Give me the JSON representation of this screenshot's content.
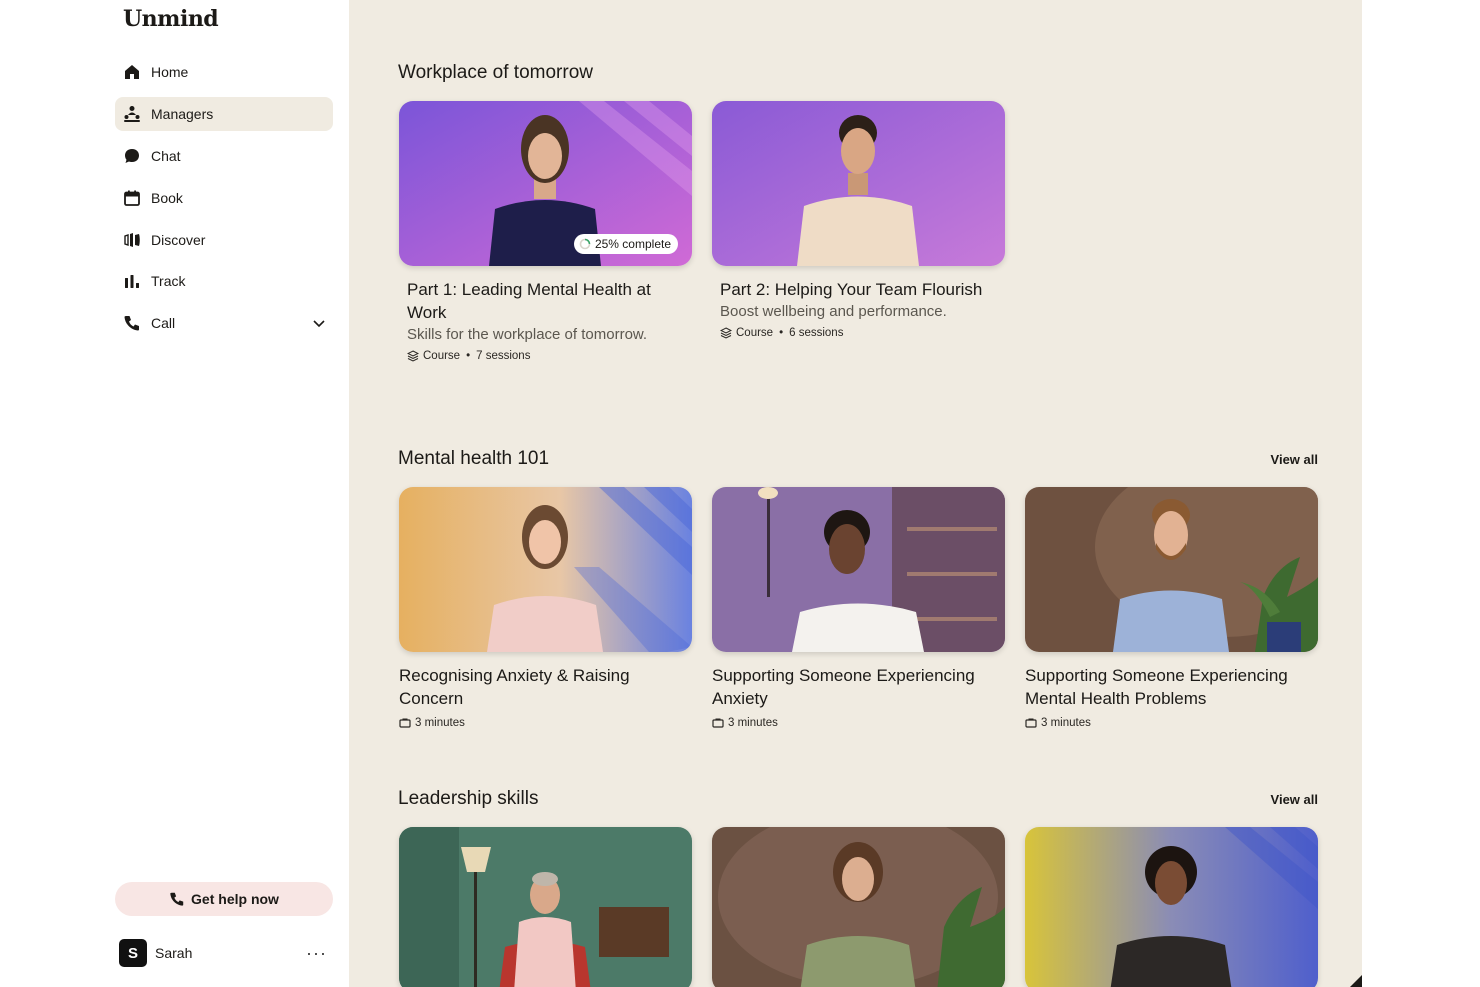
{
  "app": {
    "logo": "Unmind"
  },
  "sidebar": {
    "items": [
      {
        "label": "Home",
        "icon": "home-icon",
        "active": false
      },
      {
        "label": "Managers",
        "icon": "managers-icon",
        "active": true
      },
      {
        "label": "Chat",
        "icon": "chat-icon",
        "active": false
      },
      {
        "label": "Book",
        "icon": "calendar-icon",
        "active": false
      },
      {
        "label": "Discover",
        "icon": "discover-icon",
        "active": false
      },
      {
        "label": "Track",
        "icon": "bar-chart-icon",
        "active": false
      },
      {
        "label": "Call",
        "icon": "phone-icon",
        "active": false,
        "expandable": true
      }
    ],
    "help_button": "Get help now",
    "user": {
      "initial": "S",
      "name": "Sarah",
      "more": "···"
    }
  },
  "sections": [
    {
      "title": "Workplace of tomorrow",
      "view_all": "",
      "cards": [
        {
          "title": "Part 1: Leading Mental Health at Work",
          "subtitle": "Skills for the workplace of tomorrow.",
          "type": "Course",
          "sessions": "7 sessions",
          "progress": 25,
          "progress_label": "25% complete"
        },
        {
          "title": "Part 2: Helping Your Team Flourish",
          "subtitle": "Boost wellbeing and performance.",
          "type": "Course",
          "sessions": "6 sessions"
        }
      ]
    },
    {
      "title": "Mental health 101",
      "view_all": "View all",
      "cards": [
        {
          "title": "Recognising Anxiety & Raising Concern",
          "duration": "3 minutes"
        },
        {
          "title": "Supporting Someone Experiencing Anxiety",
          "duration": "3 minutes"
        },
        {
          "title": "Supporting Someone Experiencing Mental Health Problems",
          "duration": "3 minutes"
        }
      ]
    },
    {
      "title": "Leadership skills",
      "view_all": "View all",
      "cards": [
        {},
        {},
        {}
      ]
    }
  ],
  "colors": {
    "main_bg": "#f0ebe1",
    "active_nav": "#f0ebe1",
    "help_bg": "#f8e6e4",
    "text": "#1c1a17",
    "subtle_text": "#5b574f",
    "progress_ring": "#3aa56a"
  }
}
